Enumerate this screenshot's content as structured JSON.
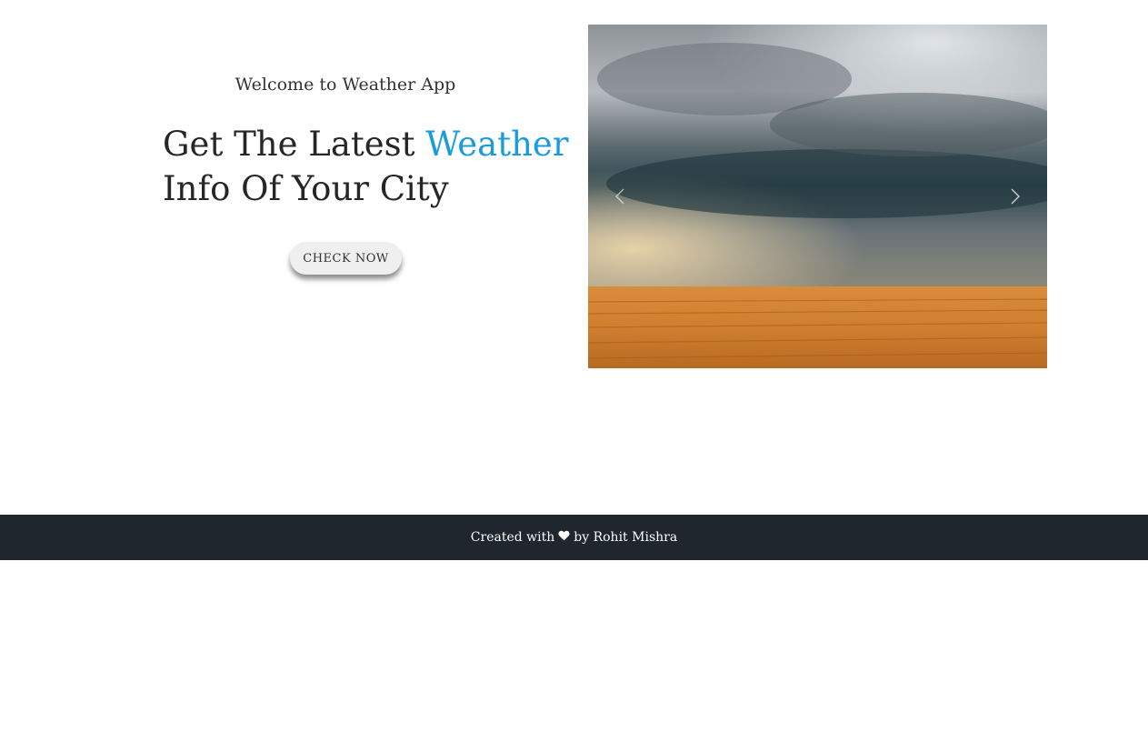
{
  "hero": {
    "welcome": "Welcome to Weather App",
    "headline_part1": "Get The Latest ",
    "headline_accent": "Weather",
    "headline_part2": "Info Of Your City",
    "cta_label": "CHECK NOW",
    "accent_color": "#1a9be0"
  },
  "carousel": {
    "prev_icon": "chevron-left-icon",
    "next_icon": "chevron-right-icon",
    "image": "storm-over-wheat-field-photo"
  },
  "footer": {
    "prefix": "Created with",
    "heart_icon": "heart-icon",
    "suffix": "by Rohit Mishra",
    "background": "#1f262e"
  }
}
